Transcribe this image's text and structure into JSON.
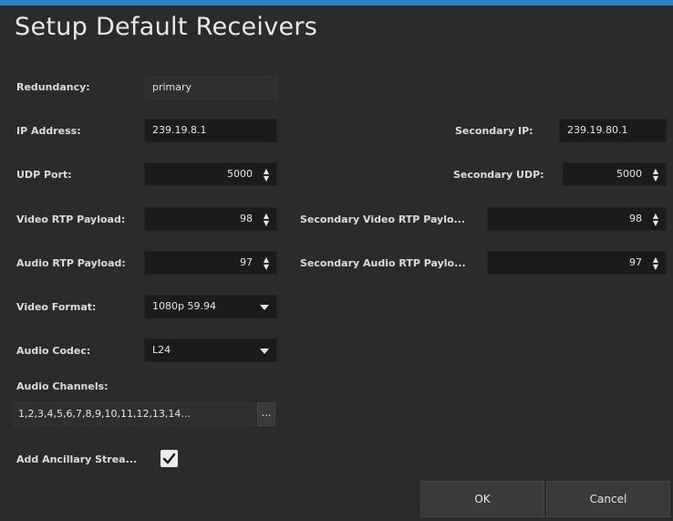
{
  "dialog": {
    "title": "Setup Default Receivers"
  },
  "fields": {
    "redundancy": {
      "label": "Redundancy:",
      "value": "primary"
    },
    "ip_address": {
      "label": "IP Address:",
      "value": "239.19.8.1"
    },
    "secondary_ip": {
      "label": "Secondary IP:",
      "value": "239.19.80.1"
    },
    "udp_port": {
      "label": "UDP Port:",
      "value": "5000"
    },
    "secondary_udp": {
      "label": "Secondary UDP:",
      "value": "5000"
    },
    "video_rtp": {
      "label": "Video RTP Payload:",
      "value": "98"
    },
    "secondary_video_rtp": {
      "label": "Secondary Video RTP Paylo...",
      "value": "98"
    },
    "audio_rtp": {
      "label": "Audio RTP Payload:",
      "value": "97"
    },
    "secondary_audio_rtp": {
      "label": "Secondary Audio RTP Paylo...",
      "value": "97"
    },
    "video_format": {
      "label": "Video Format:",
      "value": "1080p 59.94"
    },
    "audio_codec": {
      "label": "Audio Codec:",
      "value": "L24"
    },
    "audio_channels": {
      "label": "Audio Channels:",
      "value": "1,2,3,4,5,6,7,8,9,10,11,12,13,14...",
      "edit_label": "..."
    },
    "add_ancillary": {
      "label": "Add Ancillary Strea...",
      "checked": true
    }
  },
  "buttons": {
    "ok": "OK",
    "cancel": "Cancel"
  },
  "colors": {
    "accent": "#2f7fc6",
    "background": "#2b2b2b",
    "field": "#1b1b1b"
  }
}
